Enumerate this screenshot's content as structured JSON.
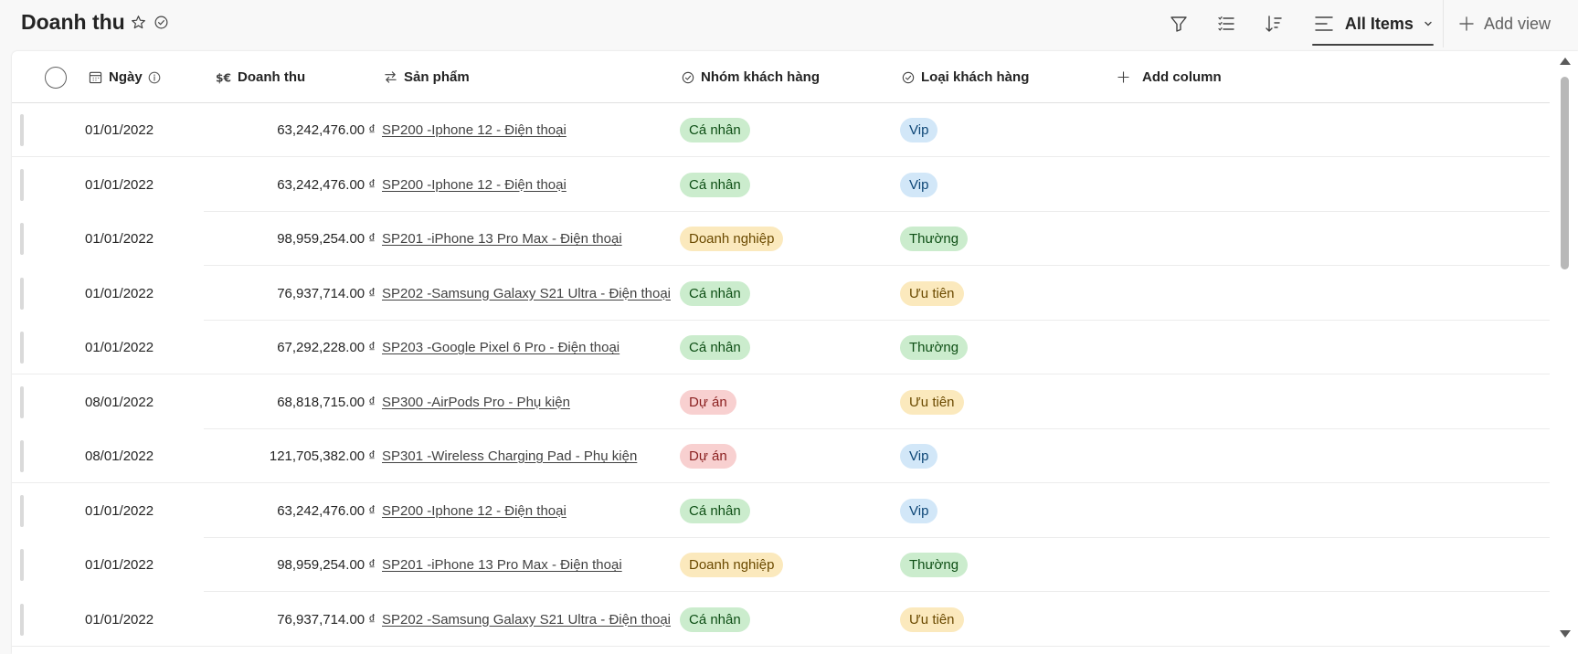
{
  "page": {
    "title": "Doanh thu"
  },
  "toolbar": {
    "view_label": "All Items",
    "add_view_label": "Add view"
  },
  "columns": {
    "date": "Ngày",
    "revenue": "Doanh thu",
    "product": "Sản phẩm",
    "customer_group": "Nhóm khách hàng",
    "customer_type": "Loại khách hàng",
    "add_column": "Add column"
  },
  "rows": [
    {
      "date": "01/01/2022",
      "revenue": "63,242,476.00 ₫",
      "product": "SP200 -Iphone 12 - Điện thoại",
      "group": "Cá nhân",
      "type": "Vip"
    },
    {
      "date": "01/01/2022",
      "revenue": "63,242,476.00 ₫",
      "product": "SP200 -Iphone 12 - Điện thoại",
      "group": "Cá nhân",
      "type": "Vip"
    },
    {
      "date": "01/01/2022",
      "revenue": "98,959,254.00 ₫",
      "product": "SP201 -iPhone 13 Pro Max - Điện thoại",
      "group": "Doanh nghiệp",
      "type": "Thường"
    },
    {
      "date": "01/01/2022",
      "revenue": "76,937,714.00 ₫",
      "product": "SP202 -Samsung Galaxy S21 Ultra - Điện thoại",
      "group": "Cá nhân",
      "type": "Ưu tiên"
    },
    {
      "date": "01/01/2022",
      "revenue": "67,292,228.00 ₫",
      "product": "SP203 -Google Pixel 6 Pro - Điện thoại",
      "group": "Cá nhân",
      "type": "Thường"
    },
    {
      "date": "08/01/2022",
      "revenue": "68,818,715.00 ₫",
      "product": "SP300 -AirPods Pro - Phụ kiện",
      "group": "Dự án",
      "type": "Ưu tiên"
    },
    {
      "date": "08/01/2022",
      "revenue": "121,705,382.00 ₫",
      "product": "SP301 -Wireless Charging Pad - Phụ kiện",
      "group": "Dự án",
      "type": "Vip"
    },
    {
      "date": "01/01/2022",
      "revenue": "63,242,476.00 ₫",
      "product": "SP200 -Iphone 12 - Điện thoại",
      "group": "Cá nhân",
      "type": "Vip"
    },
    {
      "date": "01/01/2022",
      "revenue": "98,959,254.00 ₫",
      "product": "SP201 -iPhone 13 Pro Max - Điện thoại",
      "group": "Doanh nghiệp",
      "type": "Thường"
    },
    {
      "date": "01/01/2022",
      "revenue": "76,937,714.00 ₫",
      "product": "SP202 -Samsung Galaxy S21 Ultra - Điện thoại",
      "group": "Cá nhân",
      "type": "Ưu tiên"
    }
  ],
  "pill_colors": {
    "Cá nhân": "green",
    "Doanh nghiệp": "yellow",
    "Dự án": "red",
    "Vip": "blue",
    "Thường": "green",
    "Ưu tiên": "yellow"
  },
  "icons": {
    "favorite": "star-icon",
    "status": "check-circle-icon",
    "filter": "filter-icon",
    "group": "list-icon",
    "sort": "sort-icon",
    "view": "view-lines-icon"
  }
}
